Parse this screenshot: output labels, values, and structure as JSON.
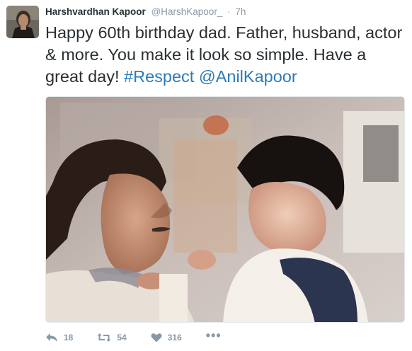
{
  "tweet": {
    "author_name": "Harshvardhan Kapoor",
    "username": "@HarshKapoor_",
    "separator": "·",
    "time": "7h",
    "text_parts": {
      "plain": "Happy 60th birthday dad. Father, husband, actor & more. You make it look so simple. Have a great day!",
      "hashtag": "#Respect",
      "mention": "@AnilKapoor"
    }
  },
  "actions": {
    "reply_count": "18",
    "retweet_count": "54",
    "like_count": "316",
    "more_label": "•••"
  },
  "colors": {
    "text": "#292f33",
    "secondary": "#8899a6",
    "link": "#2b7bb9"
  }
}
